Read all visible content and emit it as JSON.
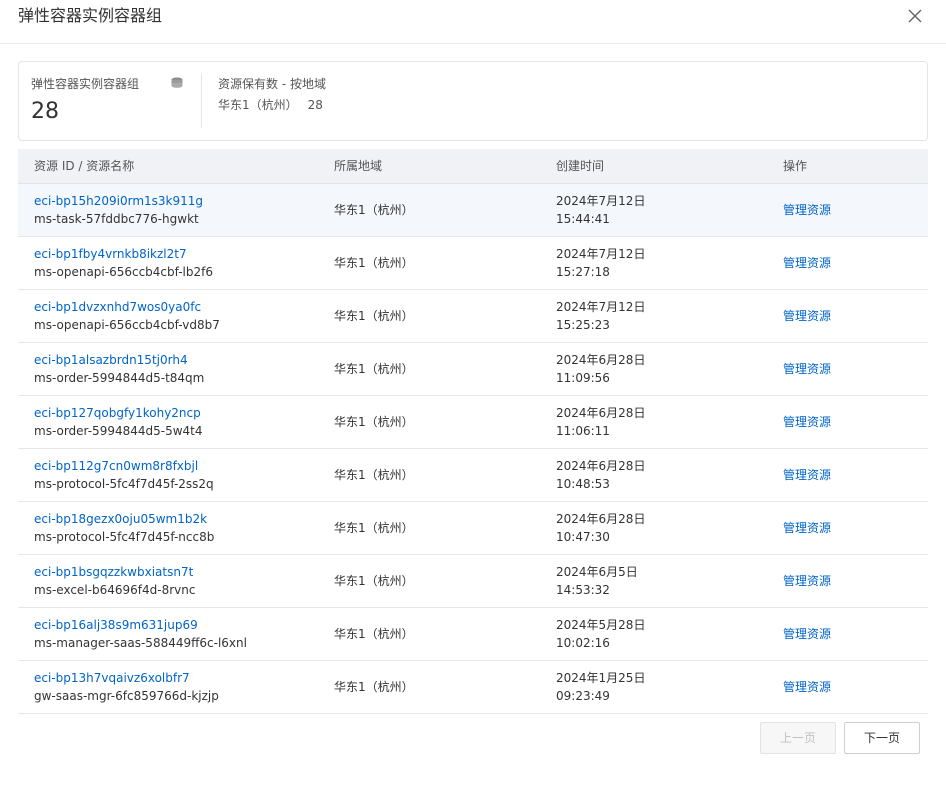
{
  "dialog": {
    "title": "弹性容器实例容器组"
  },
  "summary": {
    "label": "弹性容器实例容器组",
    "icon": "database-icon",
    "count": "28",
    "region_label": "资源保有数 - 按地域",
    "region_name": "华东1（杭州）",
    "region_count": "28"
  },
  "table": {
    "columns": [
      "资源 ID / 资源名称",
      "所属地域",
      "创建时间",
      "操作"
    ],
    "rows": [
      {
        "id": "eci-bp15h209i0rm1s3k911g",
        "name": "ms-task-57fddbc776-hgwkt",
        "region": "华东1（杭州）",
        "date": "2024年7月12日",
        "time": "15:44:41",
        "action": "管理资源"
      },
      {
        "id": "eci-bp1fby4vrnkb8ikzl2t7",
        "name": "ms-openapi-656ccb4cbf-lb2f6",
        "region": "华东1（杭州）",
        "date": "2024年7月12日",
        "time": "15:27:18",
        "action": "管理资源"
      },
      {
        "id": "eci-bp1dvzxnhd7wos0ya0fc",
        "name": "ms-openapi-656ccb4cbf-vd8b7",
        "region": "华东1（杭州）",
        "date": "2024年7月12日",
        "time": "15:25:23",
        "action": "管理资源"
      },
      {
        "id": "eci-bp1alsazbrdn15tj0rh4",
        "name": "ms-order-5994844d5-t84qm",
        "region": "华东1（杭州）",
        "date": "2024年6月28日",
        "time": "11:09:56",
        "action": "管理资源"
      },
      {
        "id": "eci-bp127qobgfy1kohy2ncp",
        "name": "ms-order-5994844d5-5w4t4",
        "region": "华东1（杭州）",
        "date": "2024年6月28日",
        "time": "11:06:11",
        "action": "管理资源"
      },
      {
        "id": "eci-bp112g7cn0wm8r8fxbjl",
        "name": "ms-protocol-5fc4f7d45f-2ss2q",
        "region": "华东1（杭州）",
        "date": "2024年6月28日",
        "time": "10:48:53",
        "action": "管理资源"
      },
      {
        "id": "eci-bp18gezx0oju05wm1b2k",
        "name": "ms-protocol-5fc4f7d45f-ncc8b",
        "region": "华东1（杭州）",
        "date": "2024年6月28日",
        "time": "10:47:30",
        "action": "管理资源"
      },
      {
        "id": "eci-bp1bsgqzzkwbxiatsn7t",
        "name": "ms-excel-b64696f4d-8rvnc",
        "region": "华东1（杭州）",
        "date": "2024年6月5日",
        "time": "14:53:32",
        "action": "管理资源"
      },
      {
        "id": "eci-bp16alj38s9m631jup69",
        "name": "ms-manager-saas-588449ff6c-l6xnl",
        "region": "华东1（杭州）",
        "date": "2024年5月28日",
        "time": "10:02:16",
        "action": "管理资源"
      },
      {
        "id": "eci-bp13h7vqaivz6xolbfr7",
        "name": "gw-saas-mgr-6fc859766d-kjzjp",
        "region": "华东1（杭州）",
        "date": "2024年1月25日",
        "time": "09:23:49",
        "action": "管理资源"
      }
    ]
  },
  "pagination": {
    "prev": "上一页",
    "next": "下一页"
  },
  "colors": {
    "link": "#0064c8",
    "header_bg": "#f0f2f5"
  }
}
